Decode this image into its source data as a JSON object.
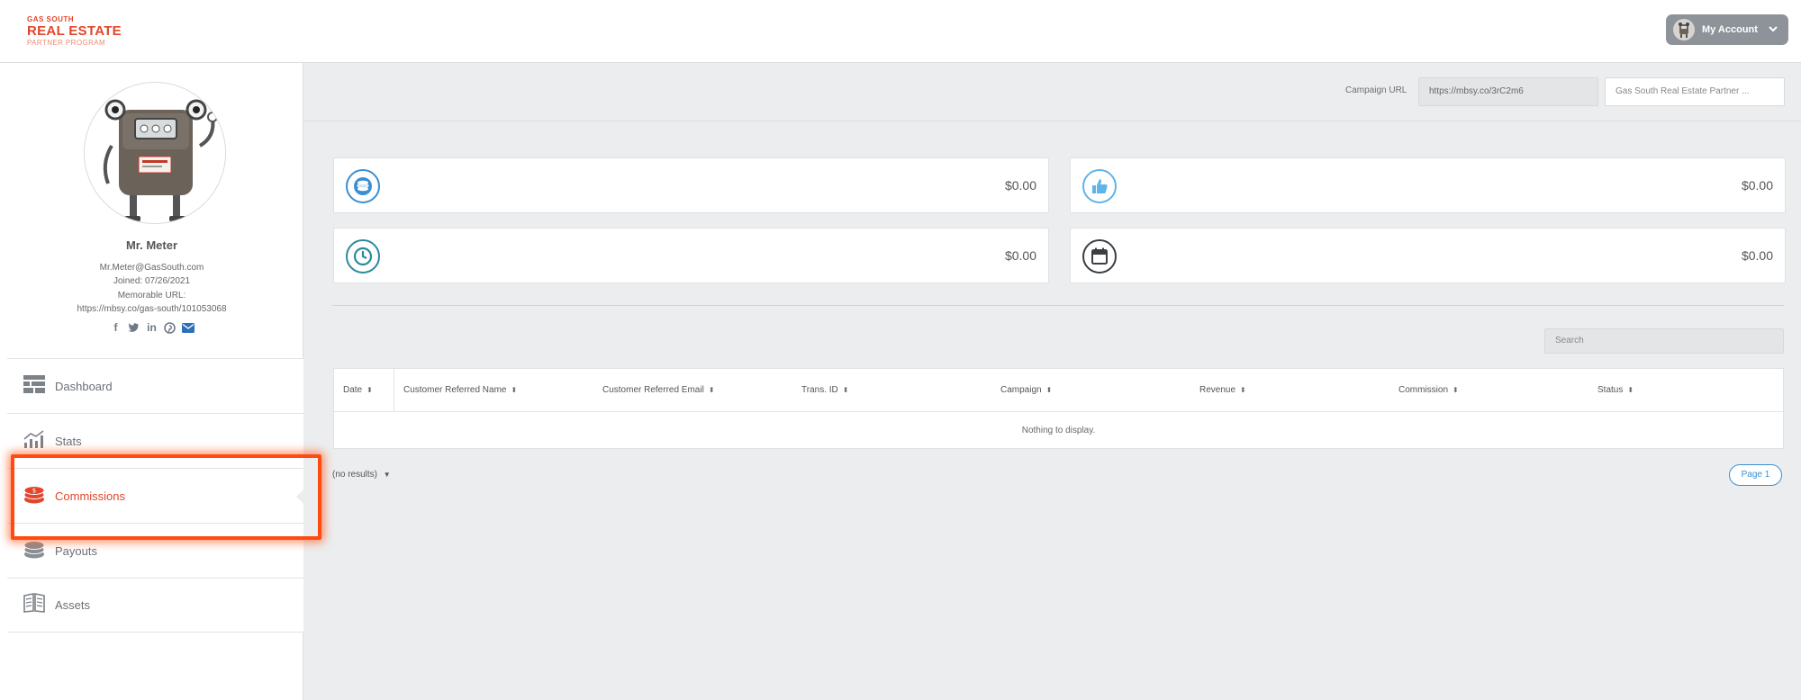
{
  "brand": {
    "line1": "GAS SOUTH",
    "line2": "REAL ESTATE",
    "line3": "PARTNER PROGRAM",
    "color": "#e2462b"
  },
  "header": {
    "account_label": "My Account",
    "account_icon": "chevron-down-icon"
  },
  "profile": {
    "name": "Mr. Meter",
    "email": "Mr.Meter@GasSouth.com",
    "joined": "Joined: 07/26/2021",
    "memorable_label": "Memorable URL:",
    "memorable_url": "https://mbsy.co/gas-south/101053068",
    "socials": [
      "facebook-icon",
      "twitter-icon",
      "linkedin-icon",
      "pinterest-icon",
      "email-icon"
    ]
  },
  "nav": {
    "items": [
      {
        "label": "Dashboard",
        "icon": "dashboard-icon"
      },
      {
        "label": "Stats",
        "icon": "stats-icon"
      },
      {
        "label": "Commissions",
        "icon": "commissions-icon",
        "active": true
      },
      {
        "label": "Payouts",
        "icon": "payouts-icon"
      },
      {
        "label": "Assets",
        "icon": "assets-icon"
      }
    ],
    "active_color": "#e2462b"
  },
  "campaign": {
    "label": "Campaign URL",
    "url": "https://mbsy.co/3rC2m6",
    "selected": "Gas South Real Estate Partner ..."
  },
  "stats": [
    {
      "icon": "coins-icon",
      "value": "$0.00"
    },
    {
      "icon": "thumbs-up-icon",
      "value": "$0.00"
    },
    {
      "icon": "clock-icon",
      "value": "$0.00"
    },
    {
      "icon": "calendar-icon",
      "value": "$0.00"
    }
  ],
  "search": {
    "placeholder": "Search"
  },
  "table": {
    "columns": [
      "Date",
      "Customer Referred Name",
      "Customer Referred Email",
      "Trans. ID",
      "Campaign",
      "Revenue",
      "Commission",
      "Status"
    ],
    "empty_message": "Nothing to display."
  },
  "footer": {
    "results_label": "(no results)",
    "page_label": "Page 1"
  },
  "colors": {
    "accent_blue": "#3a8fd3",
    "highlight": "#ff4a12"
  }
}
